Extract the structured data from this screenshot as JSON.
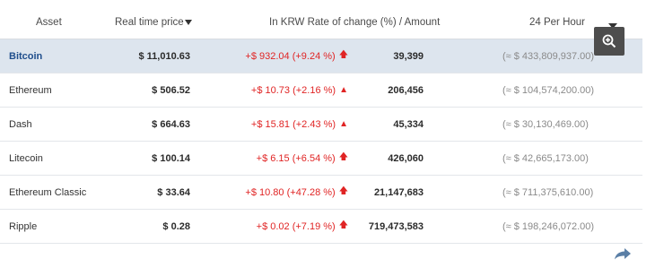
{
  "header": {
    "asset": "Asset",
    "price": "Real time price",
    "change": "In KRW Rate of change (%)  /  Amount",
    "hour": "24 Per Hour"
  },
  "rows": [
    {
      "asset": "Bitcoin",
      "price": "$ 11,010.63",
      "change": "+$ 932.04 (+9.24 %)",
      "amount": "39,399",
      "hour": "(≈ $ 433,809,937.00)"
    },
    {
      "asset": "Ethereum",
      "price": "$ 506.52",
      "change": "+$ 10.73 (+2.16 %)",
      "amount": "206,456",
      "hour": "(≈ $ 104,574,200.00)"
    },
    {
      "asset": "Dash",
      "price": "$ 664.63",
      "change": "+$ 15.81 (+2.43 %)",
      "amount": "45,334",
      "hour": "(≈ $ 30,130,469.00)"
    },
    {
      "asset": "Litecoin",
      "price": "$ 100.14",
      "change": "+$ 6.15 (+6.54 %)",
      "amount": "426,060",
      "hour": "(≈ $ 42,665,173.00)"
    },
    {
      "asset": "Ethereum Classic",
      "price": "$ 33.64",
      "change": "+$ 10.80 (+47.28 %)",
      "amount": "21,147,683",
      "hour": "(≈ $ 711,375,610.00)"
    },
    {
      "asset": "Ripple",
      "price": "$ 0.28",
      "change": "+$ 0.02 (+7.19 %)",
      "amount": "719,473,583",
      "hour": "(≈ $ 198,246,072.00)"
    }
  ],
  "colors": {
    "up": "#e02424",
    "selected_row": "#dde5ee",
    "bitcoin_link": "#1f4e8c"
  },
  "icons": {
    "zoom": "zoom-in-icon",
    "share": "share-icon",
    "up_arrow": "up-arrow-icon",
    "sort": "sort-down-icon"
  }
}
